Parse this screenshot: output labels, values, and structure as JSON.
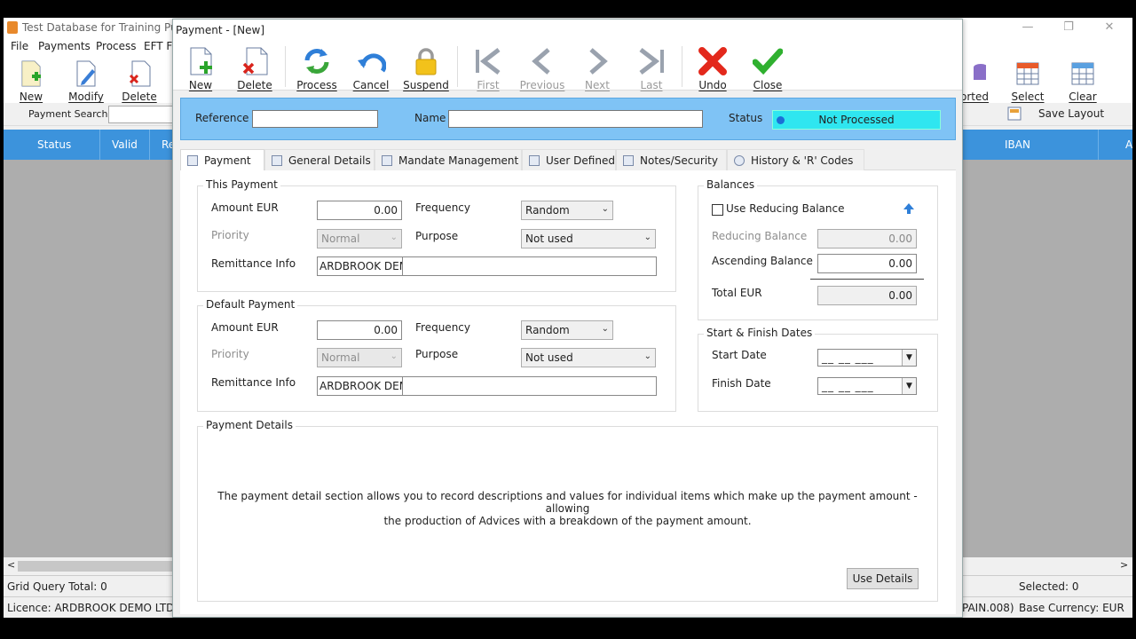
{
  "main_window": {
    "title": "Test Database for Training Purpo",
    "menu": [
      "File",
      "Payments",
      "Process",
      "EFT Fi"
    ],
    "toolbar_left": [
      "New",
      "Modify",
      "Delete"
    ],
    "toolbar_right": [
      "orted",
      "Select",
      "Clear"
    ],
    "save_layout": "Save Layout",
    "search_label": "Payment Search:",
    "grid_columns": [
      "Status",
      "Valid",
      "Re",
      "IBAN",
      "A"
    ],
    "status": {
      "grid_query_total": "Grid Query Total: 0",
      "selected": "Selected: 0",
      "licence": "Licence: ARDBROOK DEMO LTD -",
      "format": "PAIN.008)",
      "base_currency": "Base Currency: EUR"
    }
  },
  "dialog": {
    "title": "Payment - [New]",
    "toolbar": [
      {
        "label": "New",
        "icon": "new-document-icon",
        "enabled": true
      },
      {
        "label": "Delete",
        "icon": "delete-document-icon",
        "enabled": true
      },
      {
        "label": "Process",
        "icon": "process-arrows-icon",
        "enabled": true
      },
      {
        "label": "Cancel",
        "icon": "undo-arrow-icon",
        "enabled": true
      },
      {
        "label": "Suspend",
        "icon": "padlock-icon",
        "enabled": true
      },
      {
        "label": "First",
        "icon": "first-icon",
        "enabled": false
      },
      {
        "label": "Previous",
        "icon": "previous-icon",
        "enabled": false
      },
      {
        "label": "Next",
        "icon": "next-icon",
        "enabled": false
      },
      {
        "label": "Last",
        "icon": "last-icon",
        "enabled": false
      },
      {
        "label": "Undo",
        "icon": "red-x-icon",
        "enabled": true
      },
      {
        "label": "Close",
        "icon": "green-check-icon",
        "enabled": true
      }
    ],
    "header": {
      "reference_label": "Reference",
      "reference_value": "",
      "name_label": "Name",
      "name_value": "",
      "status_label": "Status",
      "status_value": "Not Processed"
    },
    "tabs": [
      "Payment",
      "General Details",
      "Mandate Management",
      "User Defined",
      "Notes/Security",
      "History & 'R' Codes"
    ],
    "this_payment": {
      "title": "This Payment",
      "amount_label": "Amount EUR",
      "amount": "0.00",
      "frequency_label": "Frequency",
      "frequency": "Random",
      "priority_label": "Priority",
      "priority": "Normal",
      "purpose_label": "Purpose",
      "purpose": "Not used",
      "remittance_label": "Remittance Info",
      "remittance_a": "ARDBROOK DEM",
      "remittance_b": ""
    },
    "default_payment": {
      "title": "Default Payment",
      "amount_label": "Amount EUR",
      "amount": "0.00",
      "frequency_label": "Frequency",
      "frequency": "Random",
      "priority_label": "Priority",
      "priority": "Normal",
      "purpose_label": "Purpose",
      "purpose": "Not used",
      "remittance_label": "Remittance Info",
      "remittance_a": "ARDBROOK DEM",
      "remittance_b": ""
    },
    "balances": {
      "title": "Balances",
      "use_reducing_label": "Use Reducing Balance",
      "use_reducing_checked": false,
      "reducing_label": "Reducing Balance",
      "reducing": "0.00",
      "ascending_label": "Ascending Balance",
      "ascending": "0.00",
      "total_label": "Total EUR",
      "total": "0.00"
    },
    "dates": {
      "title": "Start & Finish Dates",
      "start_label": "Start Date",
      "finish_label": "Finish Date",
      "placeholder": "__ __ ___"
    },
    "details": {
      "title": "Payment Details",
      "line1": "The payment detail section allows you to record descriptions and values for individual items which make up the payment amount - allowing",
      "line2": "the production of Advices with a breakdown of the payment amount.",
      "button": "Use Details"
    },
    "colors": {
      "status_fill": "#2fe6f0",
      "header_band": "#7fc3f5",
      "grid_header": "#3c93dc"
    }
  }
}
